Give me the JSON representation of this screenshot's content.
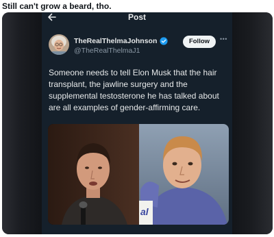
{
  "caption": "Still can't grow a beard, tho.",
  "colors": {
    "background": "#15202b",
    "text": "#e7e9ea",
    "secondary_text": "#8b98a5",
    "verified": "#1d9bf0",
    "follow_button_bg": "#eff3f4"
  },
  "topbar": {
    "back_icon": "arrow-left-icon",
    "title": "Post"
  },
  "author": {
    "display_name": "TheRealThelmaJohnson",
    "handle": "@TheRealThelmaJ1",
    "verified_icon": "verified-badge-icon",
    "follow_label": "Follow",
    "more_icon": "more-horizontal-icon"
  },
  "tweet": {
    "lines": [
      "Someone needs to tell Elon Musk that the hair",
      "transplant, the jawline surgery and the",
      "supplemental testosterone he has talked about",
      "are all examples of gender-affirming care."
    ]
  },
  "media": {
    "photo_left": "man-speaking-photo",
    "photo_right": "young-man-photo",
    "sign_text": "al"
  }
}
